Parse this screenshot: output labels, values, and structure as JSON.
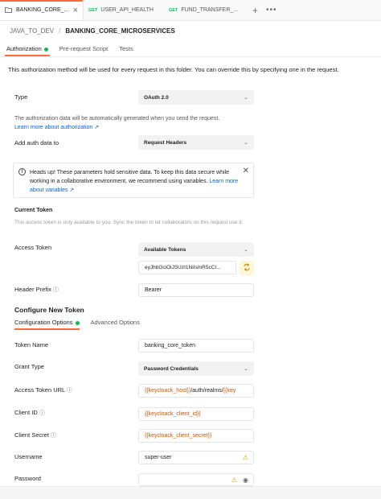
{
  "tabs": [
    {
      "label": "BANKING_CORE_...",
      "method": "",
      "icon": "folder-icon"
    },
    {
      "label": "USER_API_HEALTH",
      "method": "GET"
    },
    {
      "label": "FUND_TRANSFER_...",
      "method": "GET"
    }
  ],
  "tabbar": {
    "close": "×",
    "plus": "+",
    "more": "•••"
  },
  "breadcrumb": {
    "parent": "JAVA_TO_DEV",
    "separator": "/",
    "current": "BANKING_CORE_MICROSERVICES"
  },
  "subtabs": [
    "Authorization",
    "Pre-request Script",
    "Tests"
  ],
  "info": "This authorization method will be used for every request in this folder. You can override this by specifying one in the request.",
  "type": {
    "label": "Type",
    "value": "OAuth 2.0"
  },
  "auth_note": "The authorization data will be automatically generated when you send the request.",
  "auth_link": "Learn more about authorization ↗",
  "add_auth": {
    "label": "Add auth data to",
    "value": "Request Headers"
  },
  "alert": {
    "text": "Heads up! These parameters hold sensitive data. To keep this data secure while working in a collaborative environment, we recommend using variables.",
    "link": "Learn more about variables ↗"
  },
  "current_token": {
    "title": "Current Token",
    "note": "This access token is only available to you. Sync the token to let collaborators on this request use it.",
    "access_label": "Access Token",
    "available": "Available Tokens",
    "token_value": "eyJhbGciOiJSUzI1NiIsInR5cCI...",
    "header_prefix_label": "Header Prefix",
    "header_prefix_value": "Bearer"
  },
  "configure": {
    "title": "Configure New Token",
    "tabs": [
      "Configuration Options",
      "Advanced Options"
    ],
    "token_name_label": "Token Name",
    "token_name": "banking_core_token",
    "grant_type_label": "Grant Type",
    "grant_type": "Password Credentials",
    "access_url_label": "Access Token URL",
    "access_url_var": "{{keycloack_host}}",
    "access_url_rest": "/auth/realms/",
    "access_url_var2": "{{key",
    "client_id_label": "Client ID",
    "client_id": "{{keycloack_client_id}}",
    "client_secret_label": "Client Secret",
    "client_secret": "{{keycloack_client_secret}}",
    "username_label": "Username",
    "username": "super-user",
    "password_label": "Password"
  }
}
